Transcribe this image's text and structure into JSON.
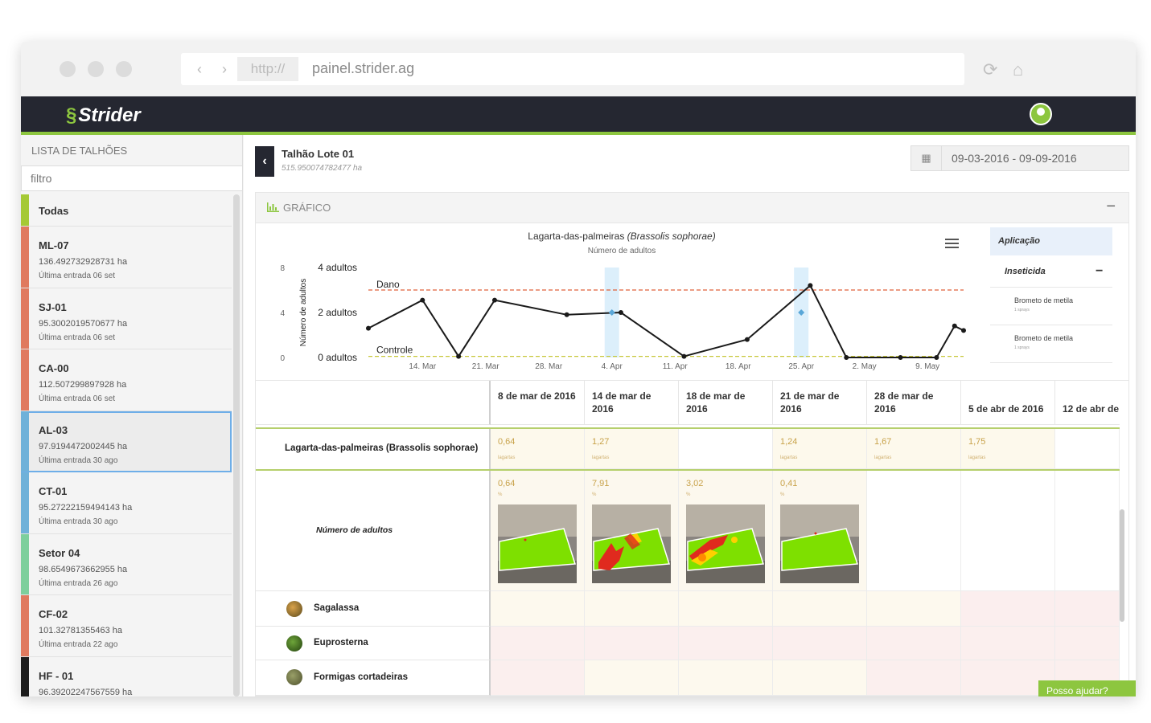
{
  "browser": {
    "protocol": "http://",
    "url": "painel.strider.ag"
  },
  "app": {
    "brand": "Strider"
  },
  "sidebar": {
    "title": "LISTA DE TALHÕES",
    "filter_placeholder": "filtro",
    "all_label": "Todas",
    "items": [
      {
        "name": "ML-07",
        "area": "136.492732928731 ha",
        "last": "Última entrada 06 set",
        "color": "#e07a5f"
      },
      {
        "name": "SJ-01",
        "area": "95.3002019570677 ha",
        "last": "Última entrada 06 set",
        "color": "#e07a5f"
      },
      {
        "name": "CA-00",
        "area": "112.507299897928 ha",
        "last": "Última entrada 06 set",
        "color": "#e07a5f"
      },
      {
        "name": "AL-03",
        "area": "97.9194472002445 ha",
        "last": "Última entrada 30 ago",
        "color": "#6fb1d9"
      },
      {
        "name": "CT-01",
        "area": "95.27222159494143 ha",
        "last": "Última entrada 30 ago",
        "color": "#6fb1d9"
      },
      {
        "name": "Setor 04",
        "area": "98.6549673662955 ha",
        "last": "Última entrada 26 ago",
        "color": "#7dcf9c"
      },
      {
        "name": "CF-02",
        "area": "101.32781355463 ha",
        "last": "Última entrada 22 ago",
        "color": "#e07a5f"
      },
      {
        "name": "HF - 01",
        "area": "96.39202247567559 ha",
        "last": "",
        "color": "#1d1d1d"
      }
    ]
  },
  "field": {
    "name": "Talhão Lote 01",
    "area": "515.950074782477 ha",
    "date_range": "09-03-2016 - 09-09-2016"
  },
  "panel": {
    "title": "GRÁFICO"
  },
  "chart_data": {
    "type": "line",
    "title": "Lagarta-das-palmeiras",
    "title_italic": "(Brassolis sophorae)",
    "subtitle": "Número de adultos",
    "ylabel": "Número de adultos",
    "y_left_ticks": [
      "0",
      "4",
      "8"
    ],
    "y_right_ticks": [
      "0 adultos",
      "2 adultos",
      "4 adultos"
    ],
    "x_ticks": [
      "14. Mar",
      "21. Mar",
      "28. Mar",
      "4. Apr",
      "11. Apr",
      "18. Apr",
      "25. Apr",
      "2. May",
      "9. May"
    ],
    "ylim": [
      0,
      4
    ],
    "x_range": [
      "2016-03-08",
      "2016-05-13"
    ],
    "thresholds": [
      {
        "name": "Dano",
        "value": 3.0,
        "color": "#e0603a"
      },
      {
        "name": "Controle",
        "value": 0.05,
        "color": "#c8c83a"
      }
    ],
    "series": [
      {
        "points": [
          [
            "2016-03-08",
            1.3
          ],
          [
            "2016-03-14",
            2.55
          ],
          [
            "2016-03-18",
            0.05
          ],
          [
            "2016-03-22",
            2.55
          ],
          [
            "2016-03-30",
            1.9
          ],
          [
            "2016-04-05",
            2.0
          ],
          [
            "2016-04-12",
            0.05
          ],
          [
            "2016-04-19",
            0.8
          ],
          [
            "2016-04-26",
            3.2
          ],
          [
            "2016-04-30",
            0.0
          ],
          [
            "2016-05-06",
            0.0
          ],
          [
            "2016-05-10",
            0.0
          ],
          [
            "2016-05-12",
            1.4
          ],
          [
            "2016-05-13",
            1.2
          ]
        ],
        "color": "#1a1a1a"
      }
    ],
    "applications": [
      {
        "date": "2016-04-04",
        "value": 2.0
      },
      {
        "date": "2016-04-25",
        "value": 2.0
      }
    ]
  },
  "legend": {
    "header": "Aplicação",
    "group": "Inseticida",
    "collapse": "−",
    "items": [
      {
        "name": "Brometo de metila",
        "sub": "1 sprays"
      },
      {
        "name": "Brometo de metila",
        "sub": "1 sprays"
      }
    ]
  },
  "table": {
    "dates": [
      "8 de mar de 2016",
      "14 de mar de 2016",
      "18 de mar de 2016",
      "21 de mar de 2016",
      "28 de mar de 2016",
      "5 de abr de 2016",
      "12 de abr de"
    ],
    "main_pest": "Lagarta-das-palmeiras (Brassolis sophorae)",
    "main_values": [
      "0,64",
      "1,27",
      "",
      "1,24",
      "1,67",
      "1,75",
      ""
    ],
    "main_unit": "lagartas",
    "adults_label": "Número de adultos",
    "adult_values": [
      "0,64",
      "7,91",
      "3,02",
      "0,41",
      "",
      "",
      ""
    ],
    "adult_unit": "%",
    "pests": [
      {
        "name": "Sagalassa",
        "icon": "sagalassa-icon"
      },
      {
        "name": "Euprosterna",
        "icon": "euprosterna-icon"
      },
      {
        "name": "Formigas cortadeiras",
        "icon": "formiga-icon"
      }
    ]
  },
  "help": {
    "label": "Posso ajudar?"
  },
  "colors": {
    "accent": "#8dc63f",
    "topbar": "#252731"
  }
}
